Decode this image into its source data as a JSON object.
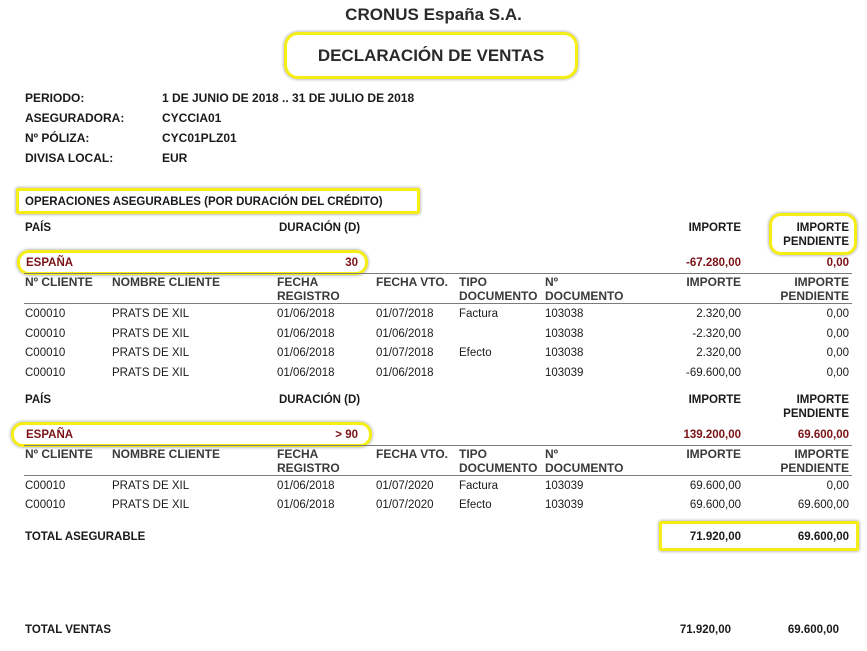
{
  "company": "CRONUS España S.A.",
  "title": "DECLARACIÓN DE VENTAS",
  "info": [
    {
      "label": "PERIODO:",
      "value": "1 DE JUNIO DE 2018 .. 31 DE JULIO DE 2018"
    },
    {
      "label": "ASEGURADORA:",
      "value": "CYCCIA01"
    },
    {
      "label": "Nº PÓLIZA:",
      "value": "CYC01PLZ01"
    },
    {
      "label": "DIVISA LOCAL:",
      "value": "EUR"
    }
  ],
  "section_title": "OPERACIONES ASEGURABLES (POR DURACIÓN DEL CRÉDITO)",
  "group_headers": {
    "pais": "PAÍS",
    "duracion": "DURACIÓN (D)",
    "importe": "IMPORTE",
    "importe_pendiente_1": "IMPORTE",
    "importe_pendiente_2": "PENDIENTE"
  },
  "detail_headers": {
    "no_cliente": "Nº CLIENTE",
    "nombre_cliente": "NOMBRE CLIENTE",
    "fecha_registro_1": "FECHA",
    "fecha_registro_2": "REGISTRO",
    "fecha_vto": "FECHA VTO.",
    "tipo_documento_1": "TIPO",
    "tipo_documento_2": "DOCUMENTO",
    "no_documento_1": "Nº",
    "no_documento_2": "DOCUMENTO",
    "importe": "IMPORTE",
    "importe_pendiente_1": "IMPORTE",
    "importe_pendiente_2": "PENDIENTE"
  },
  "groups": [
    {
      "country": "ESPAÑA",
      "duration": "30",
      "importe": "-67.280,00",
      "pendiente": "0,00",
      "rows": [
        {
          "cliente": "C00010",
          "nombre": "PRATS DE XIL",
          "fecha_registro": "01/06/2018",
          "fecha_vto": "01/07/2018",
          "tipo": "Factura",
          "documento": "103038",
          "importe": "2.320,00",
          "pendiente": "0,00"
        },
        {
          "cliente": "C00010",
          "nombre": "PRATS DE XIL",
          "fecha_registro": "01/06/2018",
          "fecha_vto": "01/06/2018",
          "tipo": "",
          "documento": "103038",
          "importe": "-2.320,00",
          "pendiente": "0,00"
        },
        {
          "cliente": "C00010",
          "nombre": "PRATS DE XIL",
          "fecha_registro": "01/06/2018",
          "fecha_vto": "01/07/2018",
          "tipo": "Efecto",
          "documento": "103038",
          "importe": "2.320,00",
          "pendiente": "0,00"
        },
        {
          "cliente": "C00010",
          "nombre": "PRATS DE XIL",
          "fecha_registro": "01/06/2018",
          "fecha_vto": "01/06/2018",
          "tipo": "",
          "documento": "103039",
          "importe": "-69.600,00",
          "pendiente": "0,00"
        }
      ]
    },
    {
      "country": "ESPAÑA",
      "duration": "> 90",
      "importe": "139.200,00",
      "pendiente": "69.600,00",
      "rows": [
        {
          "cliente": "C00010",
          "nombre": "PRATS DE XIL",
          "fecha_registro": "01/06/2018",
          "fecha_vto": "01/07/2020",
          "tipo": "Factura",
          "documento": "103039",
          "importe": "69.600,00",
          "pendiente": "0,00"
        },
        {
          "cliente": "C00010",
          "nombre": "PRATS DE XIL",
          "fecha_registro": "01/06/2018",
          "fecha_vto": "01/07/2020",
          "tipo": "Efecto",
          "documento": "103039",
          "importe": "69.600,00",
          "pendiente": "69.600,00"
        }
      ]
    }
  ],
  "total_asegurable": {
    "label": "TOTAL ASEGURABLE",
    "importe": "71.920,00",
    "pendiente": "69.600,00"
  },
  "total_ventas": {
    "label": "TOTAL VENTAS",
    "importe": "71.920,00",
    "pendiente": "69.600,00"
  },
  "colors": {
    "highlight": "#f5ee14",
    "country_red": "#7a1216"
  }
}
